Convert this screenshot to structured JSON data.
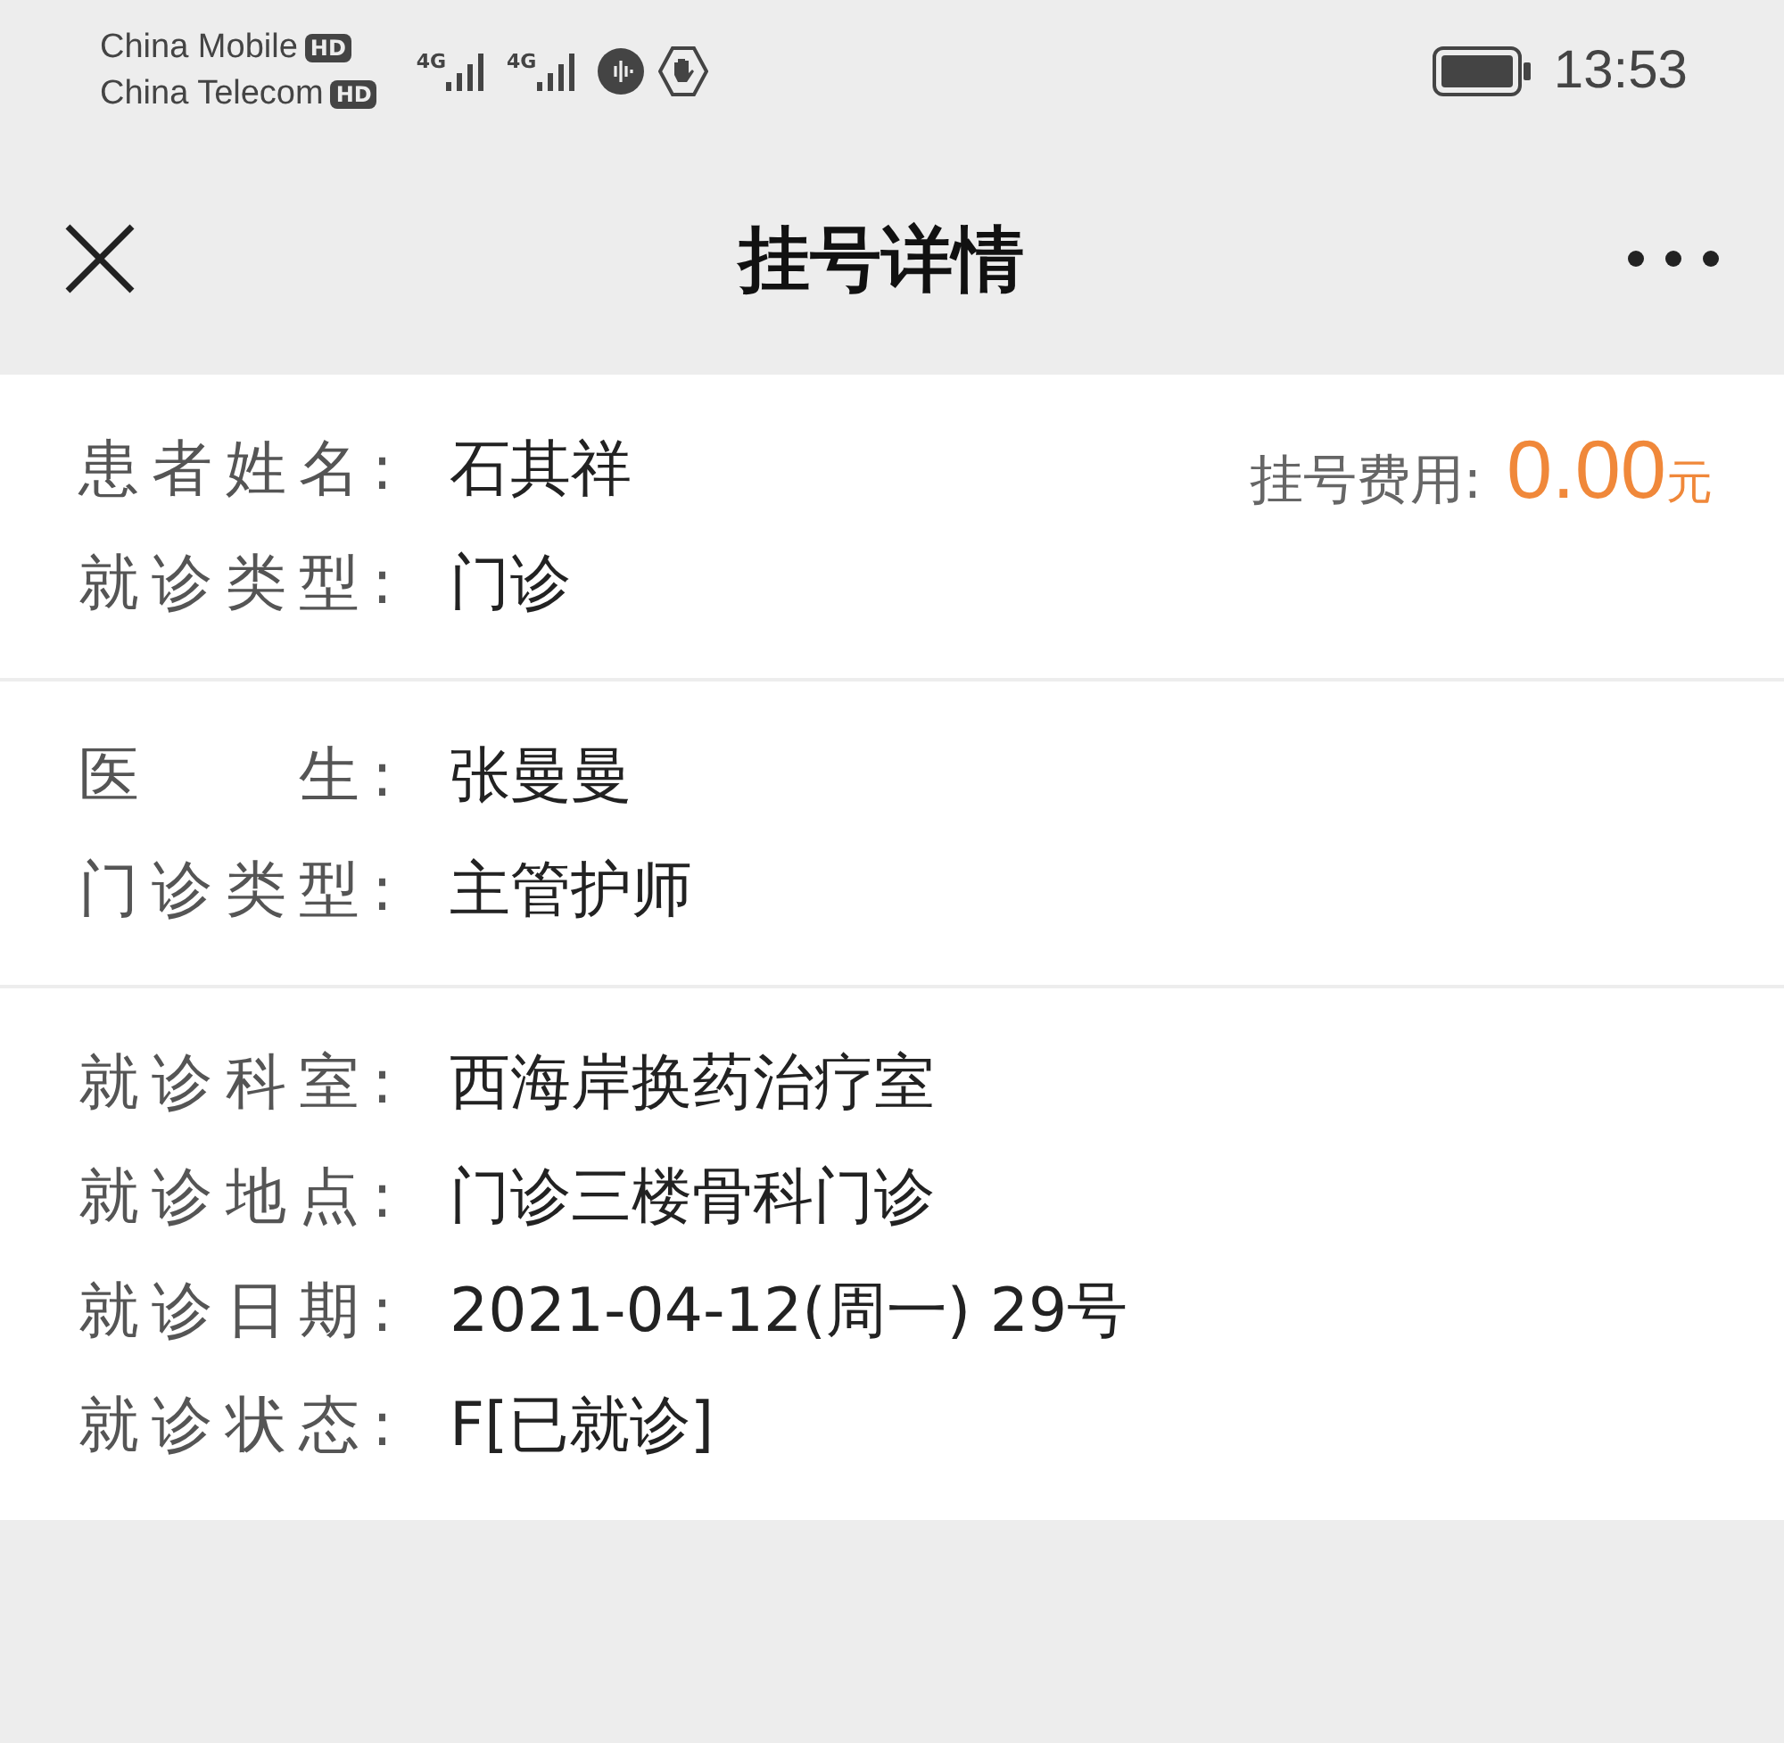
{
  "status_bar": {
    "carriers": [
      {
        "name": "China Mobile",
        "badge": "HD"
      },
      {
        "name": "China Telecom",
        "badge": "HD"
      }
    ],
    "network": [
      "4G",
      "4G"
    ],
    "time": "13:53"
  },
  "header": {
    "title": "挂号详情"
  },
  "fee": {
    "label": "挂号费用:",
    "amount": "0.00",
    "unit": "元"
  },
  "sections": [
    {
      "rows": [
        {
          "label": "患者姓名:",
          "value": "石其祥"
        },
        {
          "label": "就诊类型:",
          "value": "门诊"
        }
      ]
    },
    {
      "rows": [
        {
          "label": "医　　生:",
          "value": "张曼曼"
        },
        {
          "label": "门诊类型:",
          "value": "主管护师"
        }
      ]
    },
    {
      "rows": [
        {
          "label": "就诊科室:",
          "value": "西海岸换药治疗室"
        },
        {
          "label": "就诊地点:",
          "value": "门诊三楼骨科门诊"
        },
        {
          "label": "就诊日期:",
          "value": "2021-04-12(周一) 29号"
        },
        {
          "label": "就诊状态:",
          "value": "F[已就诊]"
        }
      ]
    }
  ]
}
